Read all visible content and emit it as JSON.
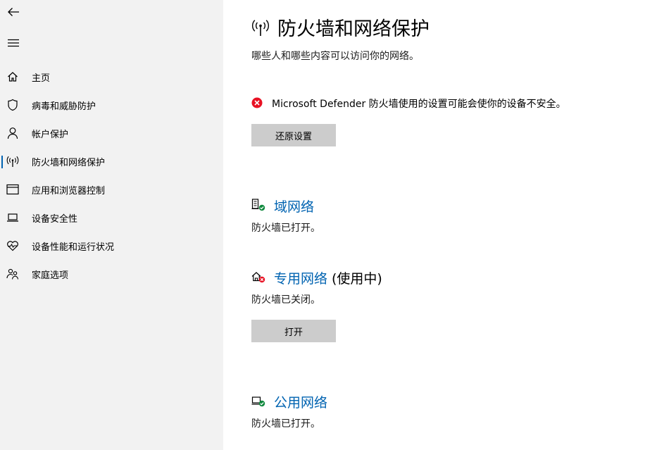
{
  "sidebar": {
    "items": [
      {
        "label": "主页",
        "icon": "home-icon"
      },
      {
        "label": "病毒和威胁防护",
        "icon": "shield-icon"
      },
      {
        "label": "帐户保护",
        "icon": "person-icon"
      },
      {
        "label": "防火墙和网络保护",
        "icon": "wireless-antenna-icon",
        "selected": true
      },
      {
        "label": "应用和浏览器控制",
        "icon": "browser-window-icon"
      },
      {
        "label": "设备安全性",
        "icon": "laptop-icon"
      },
      {
        "label": "设备性能和运行状况",
        "icon": "heart-pulse-icon"
      },
      {
        "label": "家庭选项",
        "icon": "family-icon"
      }
    ]
  },
  "main": {
    "title": "防火墙和网络保护",
    "subtitle": "哪些人和哪些内容可以访问你的网络。",
    "warning": "Microsoft Defender 防火墙使用的设置可能会使你的设备不安全。",
    "restore_button": "还原设置",
    "networks": [
      {
        "name": "域网络",
        "suffix": "",
        "status": "防火墙已打开。",
        "state": "on"
      },
      {
        "name": "专用网络",
        "suffix": "(使用中)",
        "status": "防火墙已关闭。",
        "state": "off",
        "button": "打开"
      },
      {
        "name": "公用网络",
        "suffix": "",
        "status": "防火墙已打开。",
        "state": "on"
      }
    ]
  },
  "colors": {
    "accent": "#0063b1",
    "error": "#e81123",
    "success": "#10893e",
    "sidebar_bg": "#f2f2f2",
    "button_bg": "#cccccc"
  }
}
